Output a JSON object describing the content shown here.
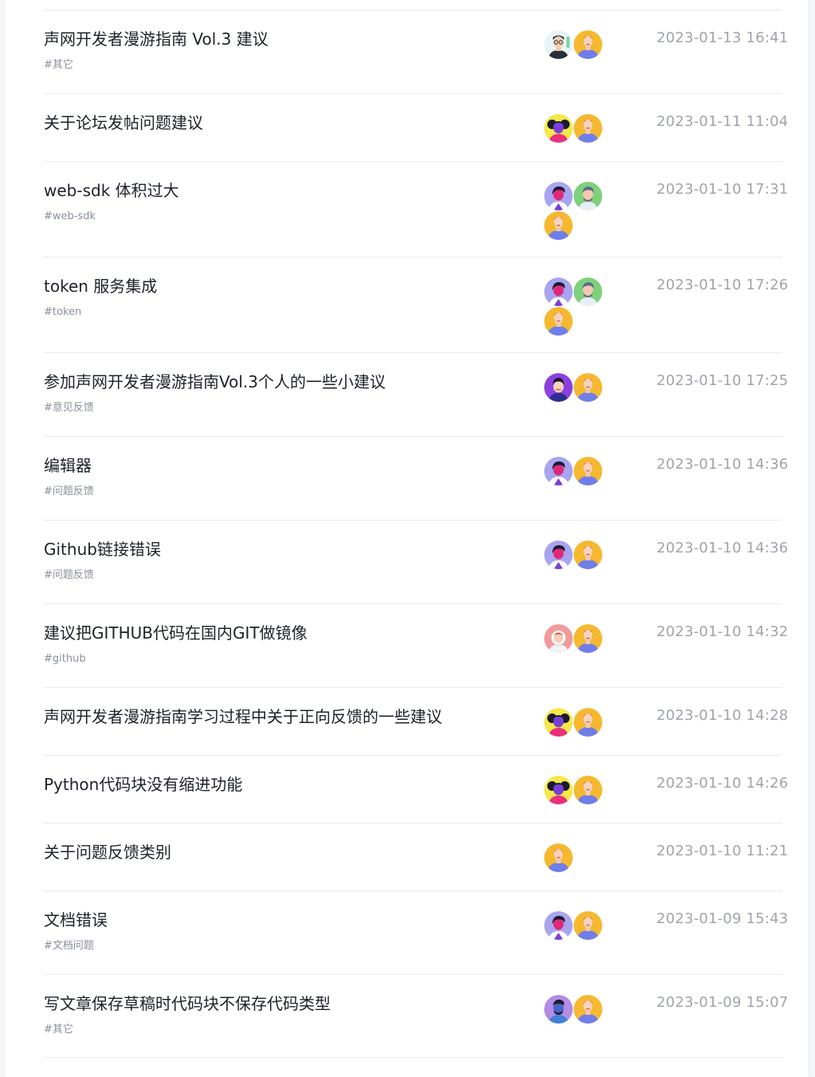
{
  "topics": [
    {
      "title": "声网开发者漫游指南 Vol.3 建议",
      "tag": "#其它",
      "time": "2023-01-13 16:41",
      "avatars": [
        "avatar-glasses-man",
        "avatar-orange-man"
      ]
    },
    {
      "title": "关于论坛发帖问题建议",
      "tag": "",
      "time": "2023-01-11 11:04",
      "avatars": [
        "avatar-yellow-woman",
        "avatar-orange-man"
      ]
    },
    {
      "title": "web-sdk 体积过大",
      "tag": "#web-sdk",
      "time": "2023-01-10 17:31",
      "avatars": [
        "avatar-purple-woman",
        "avatar-green-man",
        "avatar-orange-man"
      ]
    },
    {
      "title": "token 服务集成",
      "tag": "#token",
      "time": "2023-01-10 17:26",
      "avatars": [
        "avatar-purple-woman",
        "avatar-green-man",
        "avatar-orange-man"
      ]
    },
    {
      "title": "参加声网开发者漫游指南Vol.3个人的一些小建议",
      "tag": "#意见反馈",
      "time": "2023-01-10 17:25",
      "avatars": [
        "avatar-violet-person",
        "avatar-orange-man"
      ]
    },
    {
      "title": "编辑器",
      "tag": "#问题反馈",
      "time": "2023-01-10 14:36",
      "avatars": [
        "avatar-purple-woman",
        "avatar-orange-man"
      ]
    },
    {
      "title": "Github链接错误",
      "tag": "#问题反馈",
      "time": "2023-01-10 14:36",
      "avatars": [
        "avatar-purple-woman",
        "avatar-orange-man"
      ]
    },
    {
      "title": "建议把GITHUB代码在国内GIT做镜像",
      "tag": "#github",
      "time": "2023-01-10 14:32",
      "avatars": [
        "avatar-pink-astronaut",
        "avatar-orange-man"
      ]
    },
    {
      "title": "声网开发者漫游指南学习过程中关于正向反馈的一些建议",
      "tag": "",
      "time": "2023-01-10 14:28",
      "avatars": [
        "avatar-yellow-woman",
        "avatar-orange-man"
      ]
    },
    {
      "title": "Python代码块没有缩进功能",
      "tag": "",
      "time": "2023-01-10 14:26",
      "avatars": [
        "avatar-yellow-woman",
        "avatar-orange-man"
      ]
    },
    {
      "title": "关于问题反馈类别",
      "tag": "",
      "time": "2023-01-10 11:21",
      "avatars": [
        "avatar-orange-man"
      ]
    },
    {
      "title": "文档错误",
      "tag": "#文档问题",
      "time": "2023-01-09 15:43",
      "avatars": [
        "avatar-purple-woman",
        "avatar-orange-man"
      ]
    },
    {
      "title": "写文章保存草稿时代码块不保存代码类型",
      "tag": "#其它",
      "time": "2023-01-09 15:07",
      "avatars": [
        "avatar-lavender-man",
        "avatar-orange-man"
      ]
    }
  ]
}
